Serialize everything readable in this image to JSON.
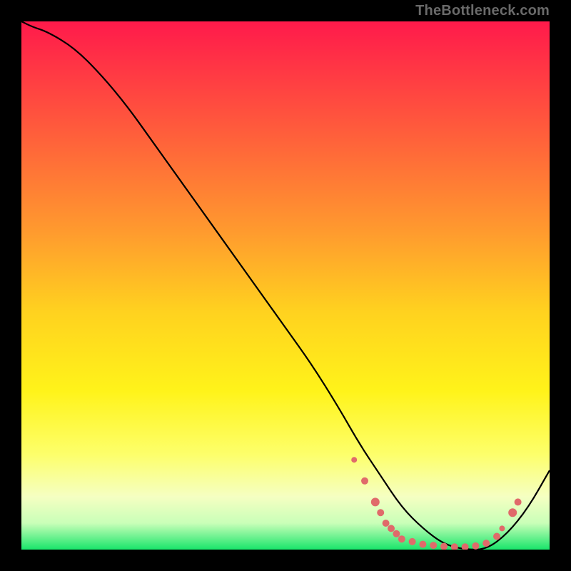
{
  "watermark": "TheBottleneck.com",
  "gradient": {
    "stops": [
      {
        "offset": 0.0,
        "color": "#ff1a4b"
      },
      {
        "offset": 0.2,
        "color": "#ff5a3c"
      },
      {
        "offset": 0.4,
        "color": "#ff9b2e"
      },
      {
        "offset": 0.55,
        "color": "#ffd21f"
      },
      {
        "offset": 0.7,
        "color": "#fff31a"
      },
      {
        "offset": 0.82,
        "color": "#fdff6b"
      },
      {
        "offset": 0.9,
        "color": "#f5ffc2"
      },
      {
        "offset": 0.95,
        "color": "#c9ffb8"
      },
      {
        "offset": 1.0,
        "color": "#19e56b"
      }
    ]
  },
  "chart_data": {
    "type": "line",
    "title": "",
    "xlabel": "",
    "ylabel": "",
    "xlim": [
      0,
      100
    ],
    "ylim": [
      0,
      100
    ],
    "series": [
      {
        "name": "curve",
        "x": [
          0,
          2,
          5,
          10,
          15,
          20,
          25,
          30,
          35,
          40,
          45,
          50,
          55,
          60,
          64,
          68,
          72,
          76,
          80,
          84,
          88,
          92,
          96,
          100
        ],
        "y": [
          100,
          99,
          98,
          95,
          90,
          84,
          77,
          70,
          63,
          56,
          49,
          42,
          35,
          27,
          20,
          14,
          8,
          4,
          1,
          0,
          0,
          3,
          8,
          15
        ]
      }
    ],
    "markers": {
      "name": "valley-dots",
      "color": "#e06a6a",
      "points": [
        {
          "x": 63,
          "y": 17,
          "r": 4
        },
        {
          "x": 65,
          "y": 13,
          "r": 5
        },
        {
          "x": 67,
          "y": 9,
          "r": 6
        },
        {
          "x": 68,
          "y": 7,
          "r": 5
        },
        {
          "x": 69,
          "y": 5,
          "r": 5
        },
        {
          "x": 70,
          "y": 4,
          "r": 5
        },
        {
          "x": 71,
          "y": 3,
          "r": 5
        },
        {
          "x": 72,
          "y": 2,
          "r": 5
        },
        {
          "x": 74,
          "y": 1.5,
          "r": 5
        },
        {
          "x": 76,
          "y": 1,
          "r": 5
        },
        {
          "x": 78,
          "y": 0.8,
          "r": 5
        },
        {
          "x": 80,
          "y": 0.6,
          "r": 5
        },
        {
          "x": 82,
          "y": 0.5,
          "r": 5
        },
        {
          "x": 84,
          "y": 0.5,
          "r": 5
        },
        {
          "x": 86,
          "y": 0.7,
          "r": 5
        },
        {
          "x": 88,
          "y": 1.2,
          "r": 5
        },
        {
          "x": 90,
          "y": 2.5,
          "r": 5
        },
        {
          "x": 91,
          "y": 4,
          "r": 4
        },
        {
          "x": 93,
          "y": 7,
          "r": 6
        },
        {
          "x": 94,
          "y": 9,
          "r": 5
        }
      ]
    }
  }
}
